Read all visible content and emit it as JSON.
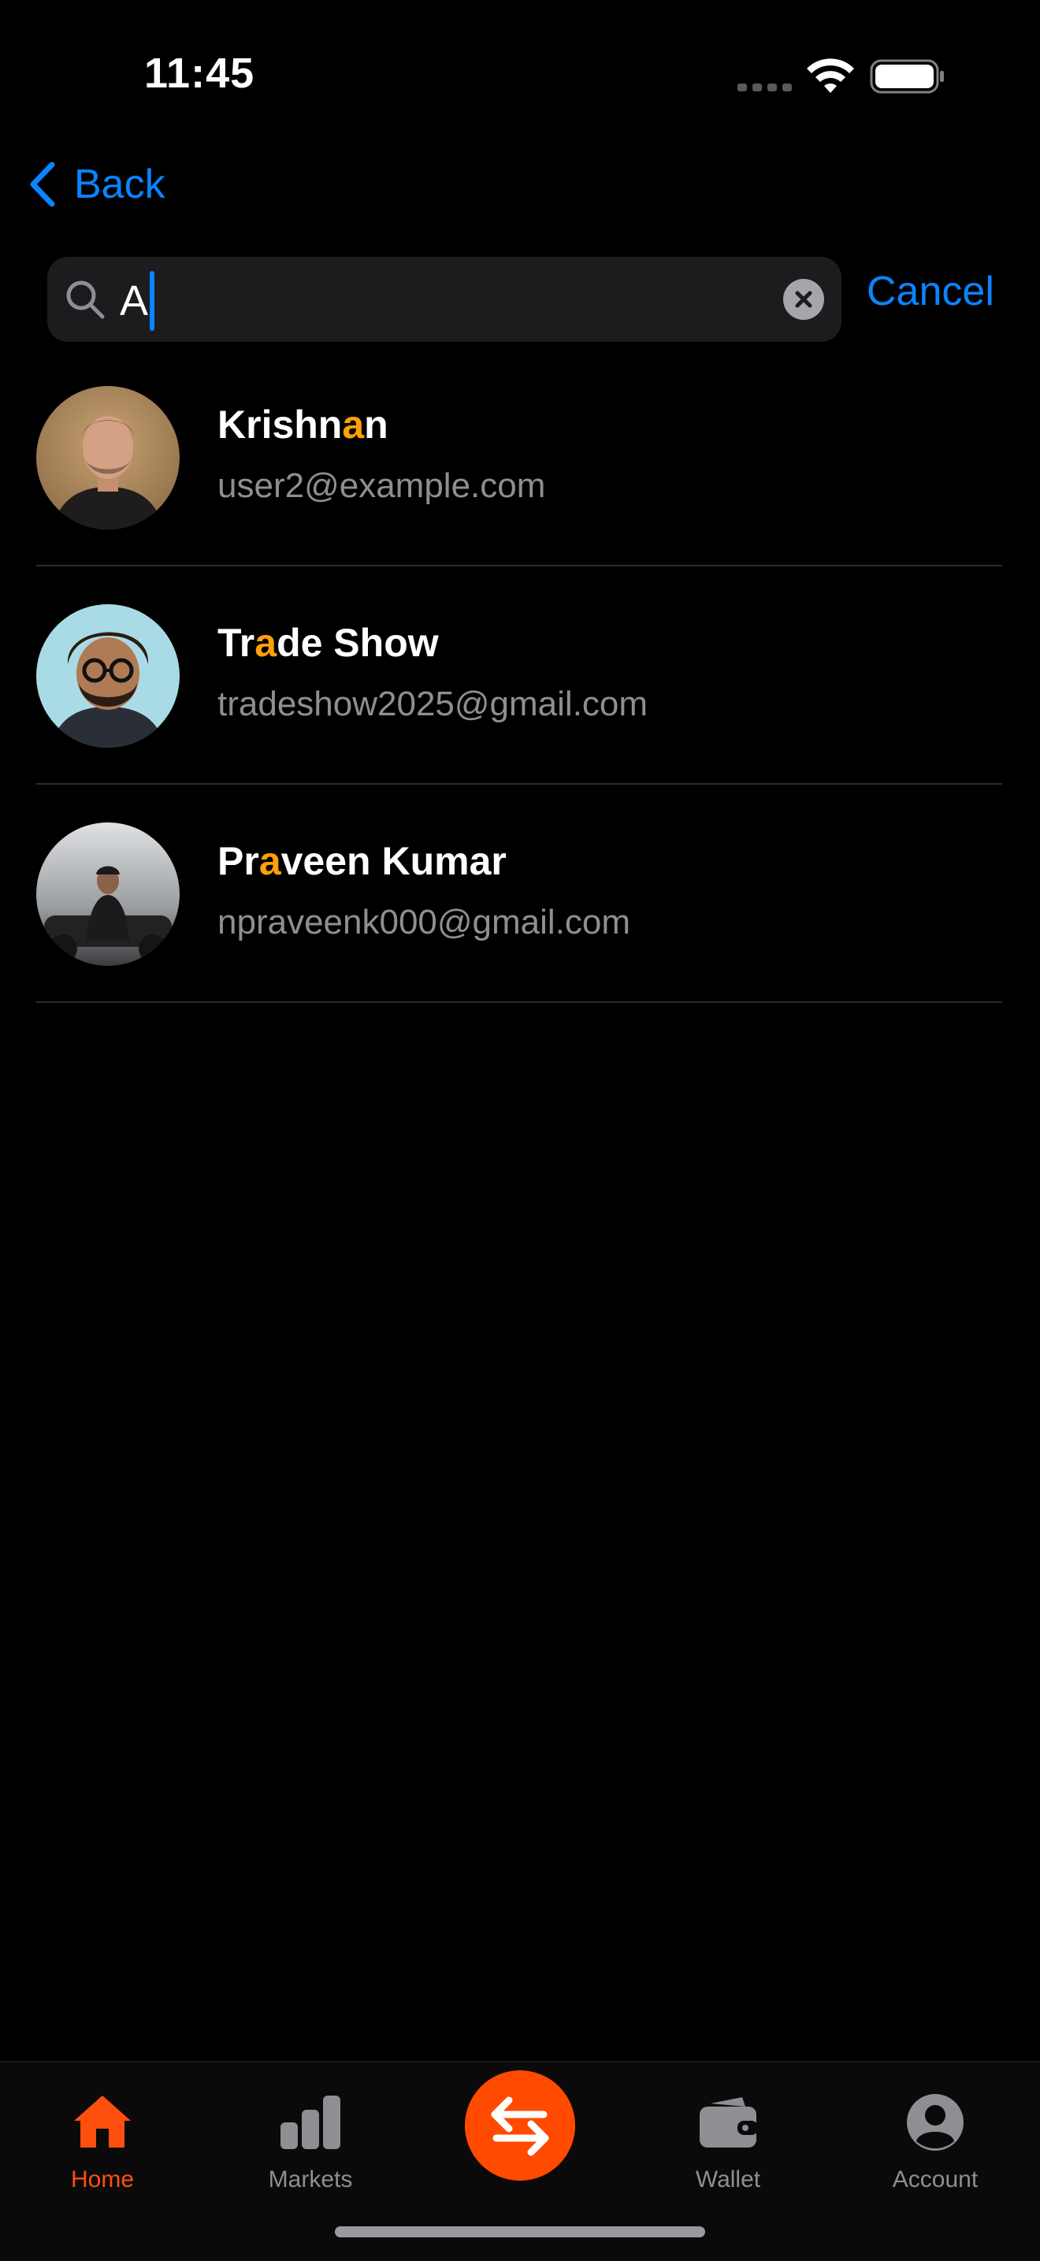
{
  "status_bar": {
    "time": "11:45"
  },
  "nav": {
    "back_label": "Back"
  },
  "search": {
    "value": "A",
    "placeholder": "",
    "cancel_label": "Cancel"
  },
  "results": [
    {
      "name_parts": [
        "Krishn",
        "a",
        "n"
      ],
      "email": "user2@example.com",
      "avatar": "person-photo-brown-background"
    },
    {
      "name_parts": [
        "Tr",
        "a",
        "de Show"
      ],
      "email": "tradeshow2025@gmail.com",
      "avatar": "illustrated-bearded-man-glasses"
    },
    {
      "name_parts": [
        "Pr",
        "a",
        "veen Kumar"
      ],
      "email": "npraveenk000@gmail.com",
      "avatar": "person-with-motorcycle-photo"
    }
  ],
  "tab_bar": {
    "items": [
      {
        "label": "Home",
        "icon": "house-icon",
        "active": true
      },
      {
        "label": "Markets",
        "icon": "bar-chart-icon",
        "active": false
      },
      {
        "label": "Wallet",
        "icon": "wallet-icon",
        "active": false
      },
      {
        "label": "Account",
        "icon": "person-circle-icon",
        "active": false
      }
    ],
    "center_icon": "swap-arrows-icon"
  },
  "colors": {
    "accent": "#0a84ff",
    "highlight": "#ff9f0a",
    "brand": "#ff4a00",
    "background": "#000000",
    "secondary_text": "#8e8e93"
  }
}
